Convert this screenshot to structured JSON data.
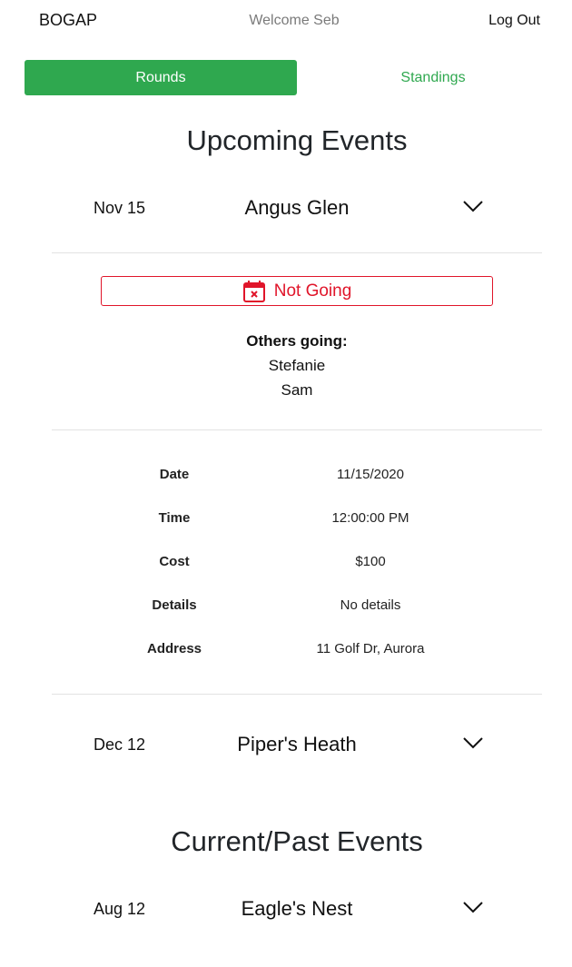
{
  "header": {
    "brand": "BOGAP",
    "welcome": "Welcome Seb",
    "logout": "Log Out"
  },
  "tabs": {
    "rounds": "Rounds",
    "standings": "Standings",
    "active": "Rounds"
  },
  "upcoming": {
    "title": "Upcoming Events",
    "events": [
      {
        "date": "Nov 15",
        "name": "Angus Glen",
        "expanded": true,
        "rsvp_label": "Not Going",
        "others_title": "Others going:",
        "others": [
          "Stefanie",
          "Sam"
        ],
        "details": [
          {
            "label": "Date",
            "value": "11/15/2020"
          },
          {
            "label": "Time",
            "value": "12:00:00 PM"
          },
          {
            "label": "Cost",
            "value": "$100"
          },
          {
            "label": "Details",
            "value": "No details"
          },
          {
            "label": "Address",
            "value": "11 Golf Dr, Aurora"
          }
        ]
      },
      {
        "date": "Dec 12",
        "name": "Piper's Heath",
        "expanded": false
      }
    ]
  },
  "past": {
    "title": "Current/Past Events",
    "events": [
      {
        "date": "Aug 12",
        "name": "Eagle's Nest",
        "expanded": false
      }
    ]
  },
  "icons": {
    "rsvp": "calendar-x-icon",
    "expand": "chevron-down-icon"
  },
  "colors": {
    "accent_green": "#2fa84f",
    "danger_red": "#e0152a"
  }
}
